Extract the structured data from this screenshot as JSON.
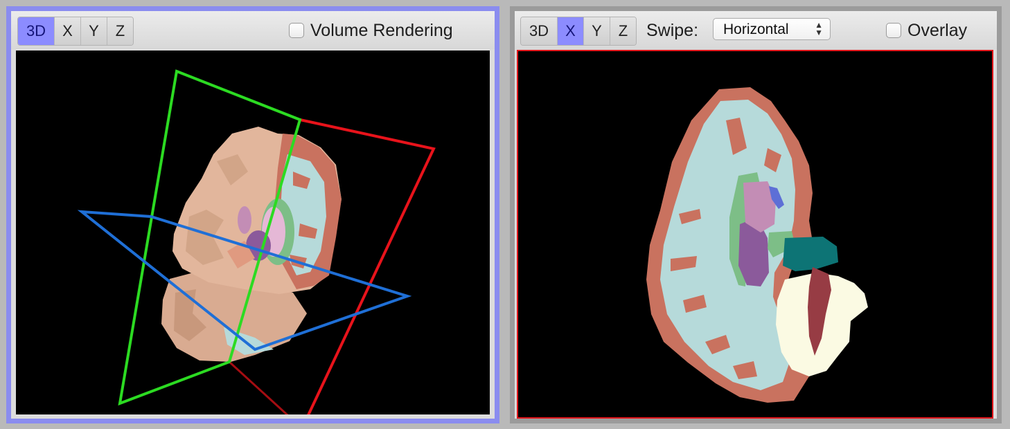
{
  "left_panel": {
    "view_buttons": [
      {
        "label": "3D",
        "active": true
      },
      {
        "label": "X",
        "active": false
      },
      {
        "label": "Y",
        "active": false
      },
      {
        "label": "Z",
        "active": false
      }
    ],
    "volume_rendering": {
      "label": "Volume Rendering",
      "checked": false
    }
  },
  "right_panel": {
    "view_buttons": [
      {
        "label": "3D",
        "active": false
      },
      {
        "label": "X",
        "active": true
      },
      {
        "label": "Y",
        "active": false
      },
      {
        "label": "Z",
        "active": false
      }
    ],
    "swipe": {
      "label": "Swipe:",
      "value": "Horizontal"
    },
    "overlay": {
      "label": "Overlay",
      "checked": false
    }
  },
  "colors": {
    "active_button": "#8c8cff",
    "left_border": "#8a8cef",
    "slice_border": "#e3161b",
    "x_plane": "#e8131b",
    "y_plane": "#2cdb22",
    "z_plane": "#1f6fd6",
    "skin": "#e2b69c",
    "cortex": "#c9725f",
    "white_matter": "#b6dada",
    "cerebellum": "#fbfae3",
    "brainstem": "#973c44",
    "ventricle_teal": "#0d7475",
    "putamen": "#8b5a9b",
    "pallidum": "#c38db5",
    "thalamus_green": "#7dbe87"
  }
}
